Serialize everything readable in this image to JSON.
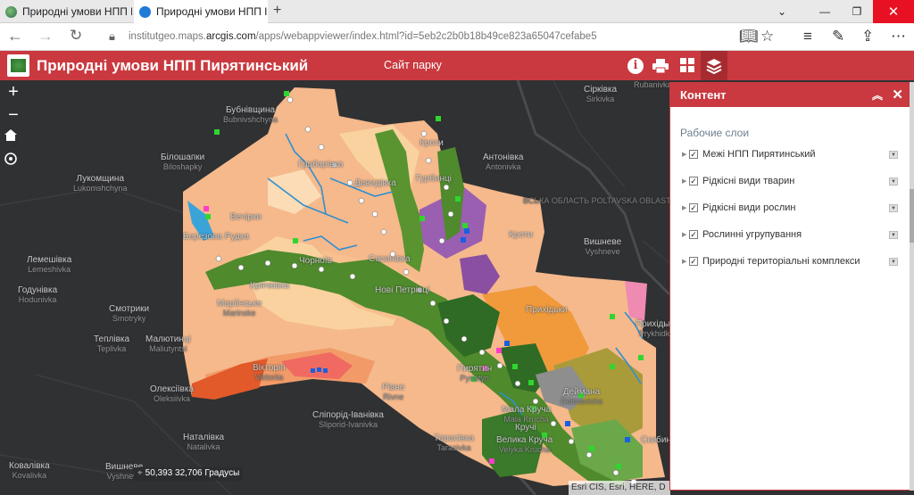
{
  "browser": {
    "tabs": [
      {
        "title": "Природні умови НПП Пир"
      },
      {
        "title": "Природні умови НПП I"
      }
    ],
    "url_prefix": "institutgeo.maps.",
    "url_domain": "arcgis.com",
    "url_suffix": "/apps/webappviewer/index.html?id=5eb2c2b0b18b49ce823a65047cefabe5"
  },
  "app": {
    "title": "Природні умови НПП Пирятинський",
    "park_link": "Сайт парку",
    "info_label": "i"
  },
  "map": {
    "coordinates": "50,393 32,706 Градусы",
    "attribution": "Esri CIS, Esri, HERE, D",
    "places": [
      {
        "name": "Бубнівщина",
        "latin": "Bubnivshchyna"
      },
      {
        "name": "Сірківка",
        "latin": "Sirkivka"
      },
      {
        "name": "Білошапки",
        "latin": "Biloshapky"
      },
      {
        "name": "Лукомщина",
        "latin": "Lukomshchyna"
      },
      {
        "name": "Антонівка",
        "latin": "Antonivka"
      },
      {
        "name": "Вишневе",
        "latin": "Vyshneve"
      },
      {
        "name": "Лемешівка",
        "latin": "Lemeshivka"
      },
      {
        "name": "Годунівка",
        "latin": "Hodunivka"
      },
      {
        "name": "Смотрики",
        "latin": "Smotryky"
      },
      {
        "name": "Маріїнське",
        "latin": "Marinske"
      },
      {
        "name": "Теплівка",
        "latin": "Teplivka"
      },
      {
        "name": "Малютинці",
        "latin": "Maliutyntsi"
      },
      {
        "name": "Олексіївка",
        "latin": "Oleksiivka"
      },
      {
        "name": "Вікторія",
        "latin": "Viktoriia"
      },
      {
        "name": "Рівне",
        "latin": "Rivne"
      },
      {
        "name": "Пирятин",
        "latin": "Pyriatyn"
      },
      {
        "name": "Деймана",
        "latin": "Deimanivka"
      },
      {
        "name": "Сліпорід-Іванівка",
        "latin": "Sliporid-Ivanivka"
      },
      {
        "name": "Наталівка",
        "latin": "Natalivka"
      },
      {
        "name": "Тарасівка",
        "latin": "Tarasivka"
      },
      {
        "name": "Вишневе",
        "latin": "Vyshneve"
      },
      {
        "name": "Ковалівка",
        "latin": "Kovalivka"
      },
      {
        "name": "Велика Круча",
        "latin": "Velyka Krucha"
      },
      {
        "name": "Мала Круча",
        "latin": "Mala Krucha"
      },
      {
        "name": "Прихідьки",
        "latin": "Prykhidky"
      },
      {
        "name": "Кручі",
        "latin": "Kruchi"
      },
      {
        "name": "Вечірки",
        "latin": "Vechirky"
      },
      {
        "name": "Березова Рудка",
        "latin": "Berezova Rudka"
      },
      {
        "name": "Грабарівка",
        "latin": "Hrabarivka"
      },
      {
        "name": "Давидівка",
        "latin": "Davydivka"
      },
      {
        "name": "Кроти",
        "latin": "Kroty"
      },
      {
        "name": "Гурбинці",
        "latin": "Hurbyntsi"
      },
      {
        "name": "Усівка",
        "latin": "Usivka"
      },
      {
        "name": "Сасинівка",
        "latin": "Sasynivka"
      },
      {
        "name": "Чорноїв",
        "latin": "Chornoiv"
      },
      {
        "name": "Крячківка",
        "latin": "Kriachkivka"
      },
      {
        "name": "Нові Петрівці",
        "latin": "Petrivtsi"
      },
      {
        "name": "Дейманівка",
        "latin": "Deimanivka"
      },
      {
        "name": "Кроти",
        "latin": "Kroty"
      },
      {
        "name": "Пирятин",
        "latin": "Pyriatyn"
      },
      {
        "name": "Прихідьки",
        "latin": "Prykhidky"
      },
      {
        "name": "Скибинці",
        "latin": "Skybyntsi"
      },
      {
        "name": "Новоселиця",
        "latin": "Novoselytsia"
      },
      {
        "name": "Рудовка",
        "latin": "Rubanivka"
      },
      {
        "name": "Годунівка",
        "latin": "Hodunivka"
      }
    ],
    "region_label": "ВСЬКА ОБЛАСТЬ  POLTAVSKA OBLAST",
    "colors": {
      "background": "#303133",
      "accent": "#c9393f"
    }
  },
  "panel": {
    "title": "Контент",
    "section": "Рабочие слои",
    "layers": [
      {
        "name": "Межі НПП Пирятинський",
        "checked": true
      },
      {
        "name": "Рідкісні види тварин",
        "checked": true
      },
      {
        "name": "Рідкісні види рослин",
        "checked": true
      },
      {
        "name": "Рослинні угрупування",
        "checked": true
      },
      {
        "name": "Природні територіальні комплекси",
        "checked": true
      }
    ]
  }
}
